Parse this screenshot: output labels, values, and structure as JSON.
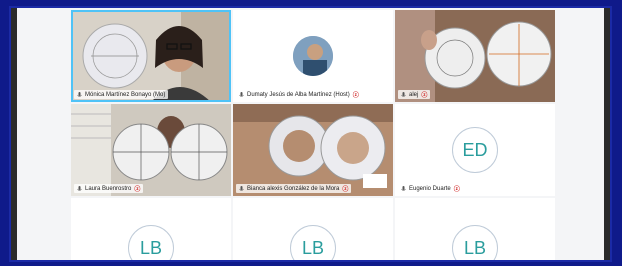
{
  "participants": [
    {
      "name": "Mónica Martínez Bonayo (Mo)",
      "muted": false
    },
    {
      "name": "Dumaty Jesús de Alba Martínez (Host)",
      "muted": true
    },
    {
      "name": "alej",
      "muted": true
    },
    {
      "name": "Laura Buenrostro",
      "muted": true
    },
    {
      "name": "Bianca alexis González de la Mora",
      "muted": true
    },
    {
      "name": "Eugenio Duarte",
      "muted": true,
      "initials": "ED"
    },
    {
      "initials": "LB"
    },
    {
      "initials": "LB"
    },
    {
      "initials": "LB"
    }
  ],
  "muted_glyph": "ⓩ",
  "colors": {
    "page_bg": "#0f1a8a",
    "active_speaker": "#4fc3f7",
    "initials": "#2a9d9d"
  }
}
